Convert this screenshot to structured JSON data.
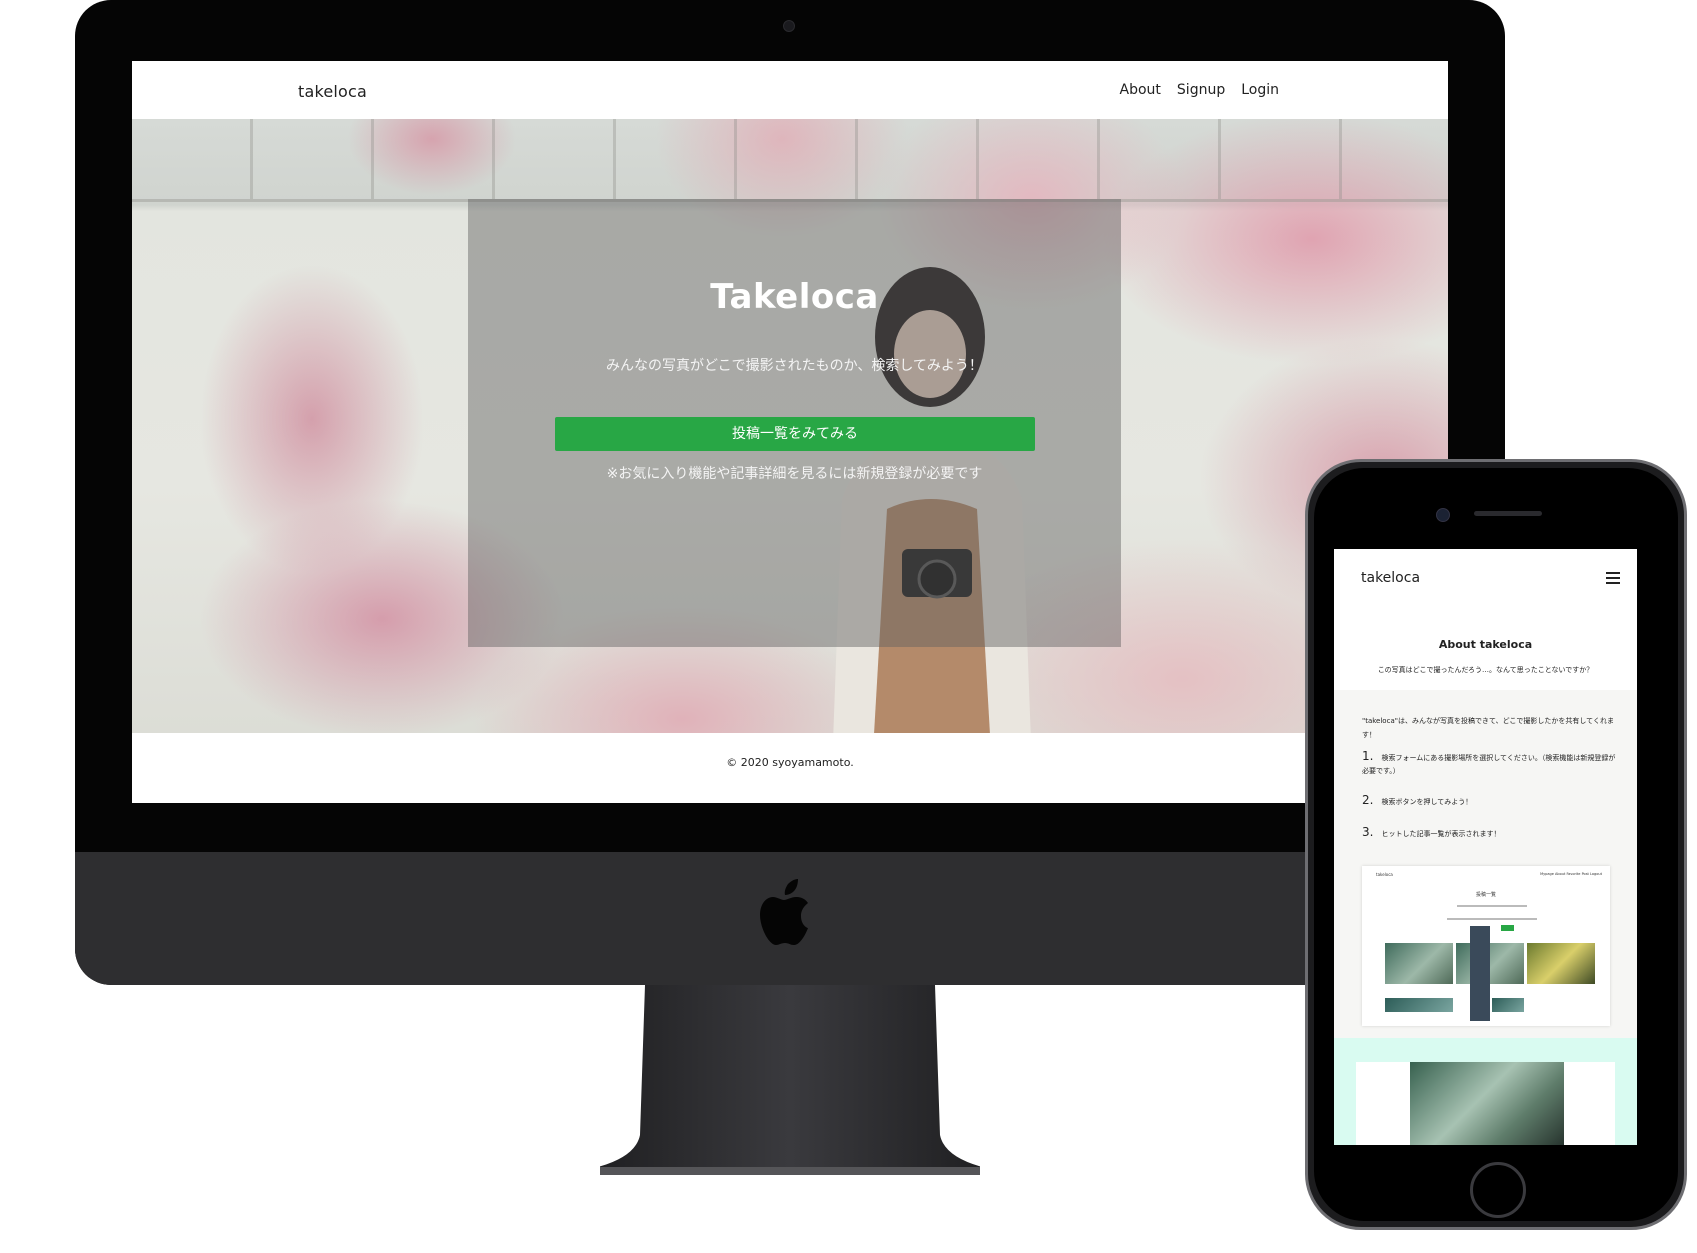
{
  "desktop": {
    "brand": "takeloca",
    "nav": {
      "about": "About",
      "signup": "Signup",
      "login": "Login"
    },
    "hero": {
      "title": "Takeloca",
      "subtitle": "みんなの写真がどこで撮影されたものか、検索してみよう！",
      "button": "投稿一覧をみてみる",
      "note": "※お気に入り機能や記事詳細を見るには新規登録が必要です"
    },
    "footer": "© 2020 syoyamamoto."
  },
  "mobile": {
    "brand": "takeloca",
    "menu_icon": "hamburger-icon",
    "about_title": "About takeloca",
    "about_subtitle": "この写真はどこで撮ったんだろう…。なんて思ったことないですか？",
    "intro": "\"takeloca\"は、みんなが写真を投稿できて、どこで撮影したかを共有してくれます！",
    "steps": [
      {
        "num": "1.",
        "text": "検索フォームにある撮影場所を選択してください。（検索機能は新規登録が必要です。）"
      },
      {
        "num": "2.",
        "text": "検索ボタンを押してみよう！"
      },
      {
        "num": "3.",
        "text": "ヒットした記事一覧が表示されます！"
      }
    ],
    "mini_screenshot": {
      "brand": "takeloca",
      "nav": "Mypage About Favorite Post Logout",
      "title": "投稿一覧"
    }
  },
  "colors": {
    "accent_green": "#28a745",
    "mint": "#d9fbf1",
    "device_black": "#050505",
    "chin_gray": "#2e2e30"
  }
}
